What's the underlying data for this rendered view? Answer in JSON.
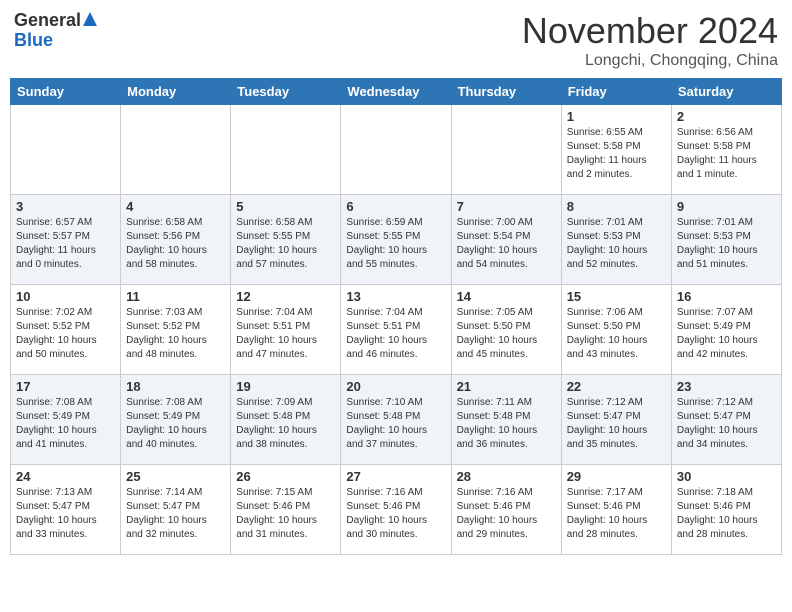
{
  "header": {
    "logo_general": "General",
    "logo_blue": "Blue",
    "month": "November 2024",
    "location": "Longchi, Chongqing, China"
  },
  "weekdays": [
    "Sunday",
    "Monday",
    "Tuesday",
    "Wednesday",
    "Thursday",
    "Friday",
    "Saturday"
  ],
  "weeks": [
    [
      {
        "day": "",
        "info": ""
      },
      {
        "day": "",
        "info": ""
      },
      {
        "day": "",
        "info": ""
      },
      {
        "day": "",
        "info": ""
      },
      {
        "day": "",
        "info": ""
      },
      {
        "day": "1",
        "info": "Sunrise: 6:55 AM\nSunset: 5:58 PM\nDaylight: 11 hours\nand 2 minutes."
      },
      {
        "day": "2",
        "info": "Sunrise: 6:56 AM\nSunset: 5:58 PM\nDaylight: 11 hours\nand 1 minute."
      }
    ],
    [
      {
        "day": "3",
        "info": "Sunrise: 6:57 AM\nSunset: 5:57 PM\nDaylight: 11 hours\nand 0 minutes."
      },
      {
        "day": "4",
        "info": "Sunrise: 6:58 AM\nSunset: 5:56 PM\nDaylight: 10 hours\nand 58 minutes."
      },
      {
        "day": "5",
        "info": "Sunrise: 6:58 AM\nSunset: 5:55 PM\nDaylight: 10 hours\nand 57 minutes."
      },
      {
        "day": "6",
        "info": "Sunrise: 6:59 AM\nSunset: 5:55 PM\nDaylight: 10 hours\nand 55 minutes."
      },
      {
        "day": "7",
        "info": "Sunrise: 7:00 AM\nSunset: 5:54 PM\nDaylight: 10 hours\nand 54 minutes."
      },
      {
        "day": "8",
        "info": "Sunrise: 7:01 AM\nSunset: 5:53 PM\nDaylight: 10 hours\nand 52 minutes."
      },
      {
        "day": "9",
        "info": "Sunrise: 7:01 AM\nSunset: 5:53 PM\nDaylight: 10 hours\nand 51 minutes."
      }
    ],
    [
      {
        "day": "10",
        "info": "Sunrise: 7:02 AM\nSunset: 5:52 PM\nDaylight: 10 hours\nand 50 minutes."
      },
      {
        "day": "11",
        "info": "Sunrise: 7:03 AM\nSunset: 5:52 PM\nDaylight: 10 hours\nand 48 minutes."
      },
      {
        "day": "12",
        "info": "Sunrise: 7:04 AM\nSunset: 5:51 PM\nDaylight: 10 hours\nand 47 minutes."
      },
      {
        "day": "13",
        "info": "Sunrise: 7:04 AM\nSunset: 5:51 PM\nDaylight: 10 hours\nand 46 minutes."
      },
      {
        "day": "14",
        "info": "Sunrise: 7:05 AM\nSunset: 5:50 PM\nDaylight: 10 hours\nand 45 minutes."
      },
      {
        "day": "15",
        "info": "Sunrise: 7:06 AM\nSunset: 5:50 PM\nDaylight: 10 hours\nand 43 minutes."
      },
      {
        "day": "16",
        "info": "Sunrise: 7:07 AM\nSunset: 5:49 PM\nDaylight: 10 hours\nand 42 minutes."
      }
    ],
    [
      {
        "day": "17",
        "info": "Sunrise: 7:08 AM\nSunset: 5:49 PM\nDaylight: 10 hours\nand 41 minutes."
      },
      {
        "day": "18",
        "info": "Sunrise: 7:08 AM\nSunset: 5:49 PM\nDaylight: 10 hours\nand 40 minutes."
      },
      {
        "day": "19",
        "info": "Sunrise: 7:09 AM\nSunset: 5:48 PM\nDaylight: 10 hours\nand 38 minutes."
      },
      {
        "day": "20",
        "info": "Sunrise: 7:10 AM\nSunset: 5:48 PM\nDaylight: 10 hours\nand 37 minutes."
      },
      {
        "day": "21",
        "info": "Sunrise: 7:11 AM\nSunset: 5:48 PM\nDaylight: 10 hours\nand 36 minutes."
      },
      {
        "day": "22",
        "info": "Sunrise: 7:12 AM\nSunset: 5:47 PM\nDaylight: 10 hours\nand 35 minutes."
      },
      {
        "day": "23",
        "info": "Sunrise: 7:12 AM\nSunset: 5:47 PM\nDaylight: 10 hours\nand 34 minutes."
      }
    ],
    [
      {
        "day": "24",
        "info": "Sunrise: 7:13 AM\nSunset: 5:47 PM\nDaylight: 10 hours\nand 33 minutes."
      },
      {
        "day": "25",
        "info": "Sunrise: 7:14 AM\nSunset: 5:47 PM\nDaylight: 10 hours\nand 32 minutes."
      },
      {
        "day": "26",
        "info": "Sunrise: 7:15 AM\nSunset: 5:46 PM\nDaylight: 10 hours\nand 31 minutes."
      },
      {
        "day": "27",
        "info": "Sunrise: 7:16 AM\nSunset: 5:46 PM\nDaylight: 10 hours\nand 30 minutes."
      },
      {
        "day": "28",
        "info": "Sunrise: 7:16 AM\nSunset: 5:46 PM\nDaylight: 10 hours\nand 29 minutes."
      },
      {
        "day": "29",
        "info": "Sunrise: 7:17 AM\nSunset: 5:46 PM\nDaylight: 10 hours\nand 28 minutes."
      },
      {
        "day": "30",
        "info": "Sunrise: 7:18 AM\nSunset: 5:46 PM\nDaylight: 10 hours\nand 28 minutes."
      }
    ]
  ]
}
